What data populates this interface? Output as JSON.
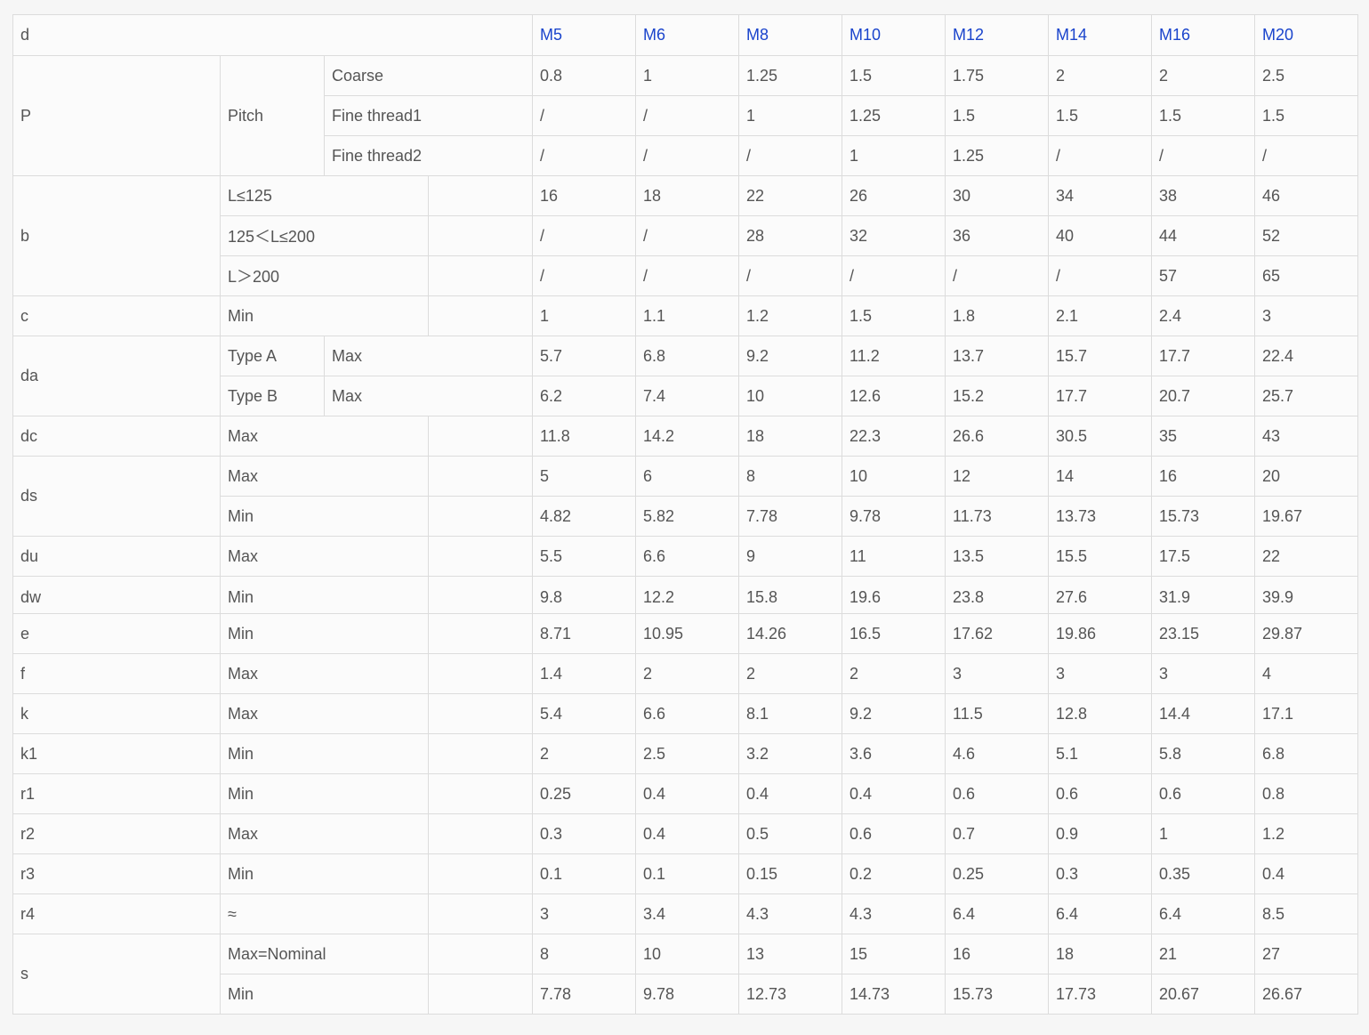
{
  "table": {
    "corner_label": "d",
    "sizes": [
      "M5",
      "M6",
      "M8",
      "M10",
      "M12",
      "M14",
      "M16",
      "M20"
    ],
    "pitch": {
      "symbol": "P",
      "group_label": "Pitch",
      "rows": [
        {
          "label": "Coarse",
          "values": [
            "0.8",
            "1",
            "1.25",
            "1.5",
            "1.75",
            "2",
            "2",
            "2.5"
          ]
        },
        {
          "label": "Fine thread1",
          "values": [
            "/",
            "/",
            "1",
            "1.25",
            "1.5",
            "1.5",
            "1.5",
            "1.5"
          ]
        },
        {
          "label": "Fine thread2",
          "values": [
            "/",
            "/",
            "/",
            "1",
            "1.25",
            "/",
            "/",
            "/"
          ]
        }
      ]
    },
    "b": {
      "symbol": "b",
      "rows": [
        {
          "label": "L≤125",
          "values": [
            "16",
            "18",
            "22",
            "26",
            "30",
            "34",
            "38",
            "46"
          ]
        },
        {
          "label": "125＜L≤200",
          "values": [
            "/",
            "/",
            "28",
            "32",
            "36",
            "40",
            "44",
            "52"
          ]
        },
        {
          "label": "L＞200",
          "values": [
            "/",
            "/",
            "/",
            "/",
            "/",
            "/",
            "57",
            "65"
          ]
        }
      ]
    },
    "c": {
      "symbol": "c",
      "label": "Min",
      "values": [
        "1",
        "1.1",
        "1.2",
        "1.5",
        "1.8",
        "2.1",
        "2.4",
        "3"
      ]
    },
    "da": {
      "symbol": "da",
      "rows": [
        {
          "type": "Type A",
          "label": "Max",
          "values": [
            "5.7",
            "6.8",
            "9.2",
            "11.2",
            "13.7",
            "15.7",
            "17.7",
            "22.4"
          ]
        },
        {
          "type": "Type B",
          "label": "Max",
          "values": [
            "6.2",
            "7.4",
            "10",
            "12.6",
            "15.2",
            "17.7",
            "20.7",
            "25.7"
          ]
        }
      ]
    },
    "dc": {
      "symbol": "dc",
      "label": "Max",
      "values": [
        "11.8",
        "14.2",
        "18",
        "22.3",
        "26.6",
        "30.5",
        "35",
        "43"
      ]
    },
    "ds": {
      "symbol": "ds",
      "rows": [
        {
          "label": "Max",
          "values": [
            "5",
            "6",
            "8",
            "10",
            "12",
            "14",
            "16",
            "20"
          ]
        },
        {
          "label": "Min",
          "values": [
            "4.82",
            "5.82",
            "7.78",
            "9.78",
            "11.73",
            "13.73",
            "15.73",
            "19.67"
          ]
        }
      ]
    },
    "du": {
      "symbol": "du",
      "label": "Max",
      "values": [
        "5.5",
        "6.6",
        "9",
        "11",
        "13.5",
        "15.5",
        "17.5",
        "22"
      ]
    },
    "dw": {
      "symbol": "dw",
      "label": "Min",
      "values": [
        "9.8",
        "12.2",
        "15.8",
        "19.6",
        "23.8",
        "27.6",
        "31.9",
        "39.9"
      ]
    },
    "e": {
      "symbol": "e",
      "label": "Min",
      "values": [
        "8.71",
        "10.95",
        "14.26",
        "16.5",
        "17.62",
        "19.86",
        "23.15",
        "29.87"
      ]
    },
    "f": {
      "symbol": "f",
      "label": "Max",
      "values": [
        "1.4",
        "2",
        "2",
        "2",
        "3",
        "3",
        "3",
        "4"
      ]
    },
    "k": {
      "symbol": "k",
      "label": "Max",
      "values": [
        "5.4",
        "6.6",
        "8.1",
        "9.2",
        "11.5",
        "12.8",
        "14.4",
        "17.1"
      ]
    },
    "k1": {
      "symbol": "k1",
      "label": "Min",
      "values": [
        "2",
        "2.5",
        "3.2",
        "3.6",
        "4.6",
        "5.1",
        "5.8",
        "6.8"
      ]
    },
    "r1": {
      "symbol": "r1",
      "label": "Min",
      "values": [
        "0.25",
        "0.4",
        "0.4",
        "0.4",
        "0.6",
        "0.6",
        "0.6",
        "0.8"
      ]
    },
    "r2": {
      "symbol": "r2",
      "label": "Max",
      "values": [
        "0.3",
        "0.4",
        "0.5",
        "0.6",
        "0.7",
        "0.9",
        "1",
        "1.2"
      ]
    },
    "r3": {
      "symbol": "r3",
      "label": "Min",
      "values": [
        "0.1",
        "0.1",
        "0.15",
        "0.2",
        "0.25",
        "0.3",
        "0.35",
        "0.4"
      ]
    },
    "r4": {
      "symbol": "r4",
      "label": "≈",
      "values": [
        "3",
        "3.4",
        "4.3",
        "4.3",
        "6.4",
        "6.4",
        "6.4",
        "8.5"
      ]
    },
    "s": {
      "symbol": "s",
      "rows": [
        {
          "label": "Max=Nominal",
          "values": [
            "8",
            "10",
            "13",
            "15",
            "16",
            "18",
            "21",
            "27"
          ]
        },
        {
          "label": "Min",
          "values": [
            "7.78",
            "9.78",
            "12.73",
            "14.73",
            "15.73",
            "17.73",
            "20.67",
            "26.67"
          ]
        }
      ]
    }
  }
}
